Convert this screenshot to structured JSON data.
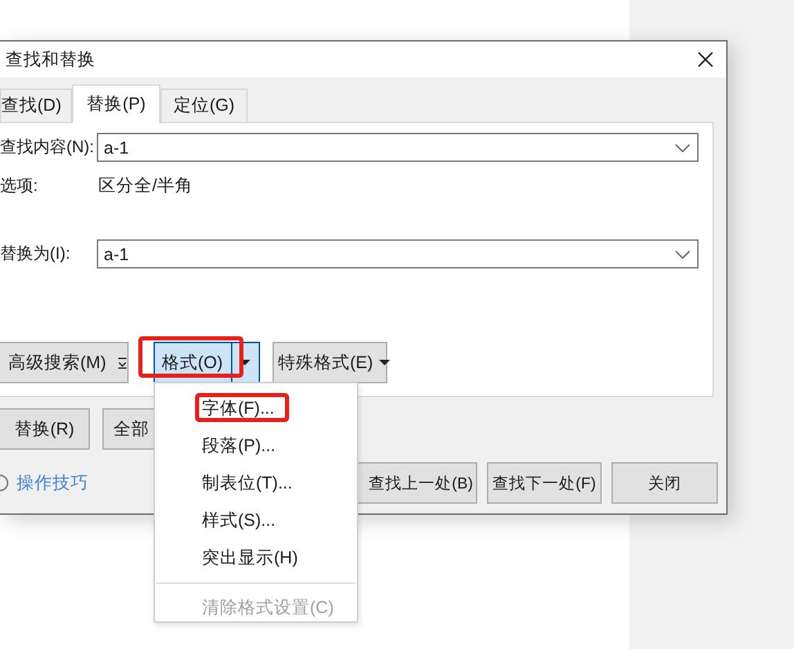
{
  "window": {
    "title": "查找和替换"
  },
  "tabs": [
    {
      "label": "查找(D)",
      "selected": false
    },
    {
      "label": "替换(P)",
      "selected": true
    },
    {
      "label": "定位(G)",
      "selected": false
    }
  ],
  "find": {
    "label": "查找内容(N):",
    "value": "a-1"
  },
  "options": {
    "label": "选项:",
    "value": "区分全/半角"
  },
  "replace": {
    "label": "替换为(I):",
    "value": "a-1"
  },
  "option_buttons": [
    {
      "label": "高级搜索(M)",
      "kind": "expand",
      "selected": false,
      "highlighted": false
    },
    {
      "label": "格式(O)",
      "kind": "dropdown",
      "selected": true,
      "highlighted": true
    },
    {
      "label": "特殊格式(E)",
      "kind": "dropdown",
      "selected": false,
      "highlighted": false
    }
  ],
  "action_buttons": [
    "替换(R)",
    "全部"
  ],
  "tips_link": "操作技巧",
  "nav_buttons": [
    "查找上一处(B)",
    "查找下一处(F)",
    "关闭"
  ],
  "format_menu": {
    "items": [
      {
        "kind": "item",
        "label": "字体(F)...",
        "disabled": false,
        "highlighted": true
      },
      {
        "kind": "item",
        "label": "段落(P)...",
        "disabled": false,
        "highlighted": false
      },
      {
        "kind": "item",
        "label": "制表位(T)...",
        "disabled": false,
        "highlighted": false
      },
      {
        "kind": "item",
        "label": "样式(S)...",
        "disabled": false,
        "highlighted": false
      },
      {
        "kind": "item",
        "label": "突出显示(H)",
        "disabled": false,
        "highlighted": false
      },
      {
        "kind": "separator"
      },
      {
        "kind": "item",
        "label": "清除格式设置(C)",
        "disabled": true,
        "highlighted": false
      }
    ]
  }
}
